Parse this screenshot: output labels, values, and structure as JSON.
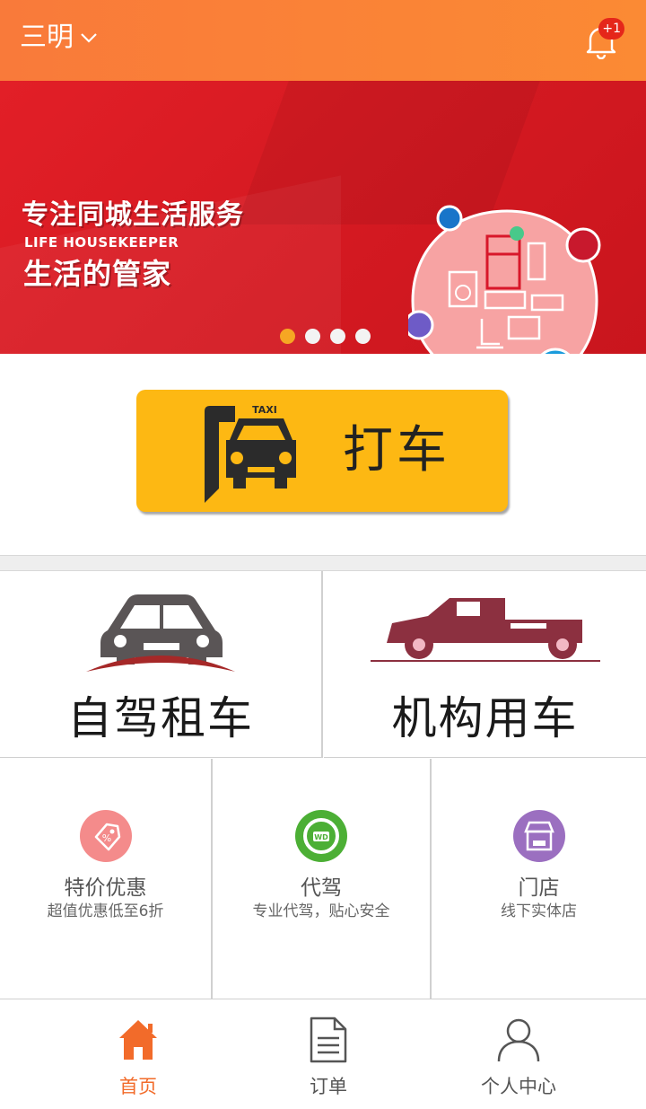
{
  "header": {
    "city": "三明",
    "notification_badge": "+1"
  },
  "banner": {
    "title": "专注同城生活服务",
    "subtitle_en": "LIFE HOUSEKEEPER",
    "subtitle_cn": "生活的管家",
    "page_count": 4,
    "active_page": 1
  },
  "taxi": {
    "label": "打车",
    "icon_text": "TAXI"
  },
  "big_tiles": [
    {
      "label": "自驾租车",
      "icon": "sedan-car-icon"
    },
    {
      "label": "机构用车",
      "icon": "vintage-car-icon"
    }
  ],
  "small_tiles": [
    {
      "title": "特价优惠",
      "subtitle": "超值优惠低至6折",
      "icon": "discount-tag-icon",
      "color": "#f48b8b"
    },
    {
      "title": "代驾",
      "subtitle": "专业代驾，贴心安全",
      "icon": "steering-wheel-icon",
      "icon_text": "WD",
      "color": "#4caf35"
    },
    {
      "title": "门店",
      "subtitle": "线下实体店",
      "icon": "storefront-icon",
      "color": "#9b6fc0"
    }
  ],
  "tabs": [
    {
      "label": "首页",
      "icon": "home-icon",
      "active": true
    },
    {
      "label": "订单",
      "icon": "document-icon",
      "active": false
    },
    {
      "label": "个人中心",
      "icon": "user-icon",
      "active": false
    }
  ],
  "colors": {
    "accent": "#f26b2a",
    "header": "#fb8a34",
    "banner": "#e21f27",
    "taxi": "#fdb813"
  }
}
